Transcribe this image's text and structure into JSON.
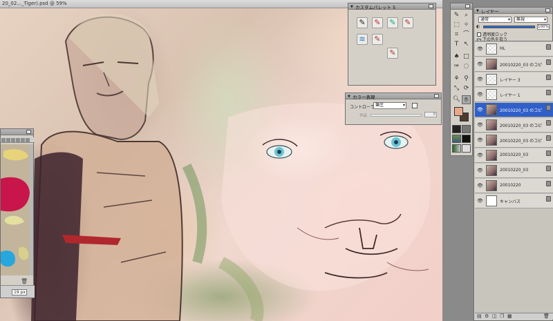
{
  "document": {
    "title": "20_02..._Tiger).psd @ 59%"
  },
  "color_panel": {
    "size_value": "19 px"
  },
  "custom_palette": {
    "title": "カスタムパレット 5",
    "brushes": [
      "brush-diagonal-icon",
      "brush-rainbow-icon",
      "brush-rainbow-icon",
      "brush-red-icon",
      "brush-blue-icon",
      "brush-red-icon",
      "brush-red-icon"
    ]
  },
  "color_expression": {
    "title": "カラー表現",
    "controller_label": "コントローラ",
    "controller_value": "筆圧",
    "param_label": "作品",
    "param_value": "0"
  },
  "tools": {
    "foreground": "#e8a98a",
    "background": "#4b3b2f"
  },
  "layer_panel": {
    "title": "レイヤー",
    "blend_mode": "通常",
    "paper_texture": "無視",
    "opacity": "100%",
    "opacity_fraction": 1.0,
    "preserve_transparency": "透明度ロック",
    "pick_underlying": "下の色を拾う",
    "layers": [
      {
        "name": "HL",
        "thumb": "trans",
        "selected": false
      },
      {
        "name": "20010220_03 のコピー 2",
        "thumb": "img",
        "selected": false
      },
      {
        "name": "レイヤー 3",
        "thumb": "trans",
        "selected": false
      },
      {
        "name": "レイヤー 1",
        "thumb": "trans",
        "selected": false
      },
      {
        "name": "20010220_03 のコピー",
        "thumb": "img",
        "selected": true
      },
      {
        "name": "20010220_03 のコピー",
        "thumb": "img",
        "selected": false
      },
      {
        "name": "20010220_03 のコピー",
        "thumb": "img",
        "selected": false
      },
      {
        "name": "20010220_03",
        "thumb": "img",
        "selected": false
      },
      {
        "name": "20010220_03",
        "thumb": "img",
        "selected": false
      },
      {
        "name": "20010220",
        "thumb": "img",
        "selected": false
      },
      {
        "name": "キャンバス",
        "thumb": "paper",
        "selected": false
      }
    ]
  }
}
